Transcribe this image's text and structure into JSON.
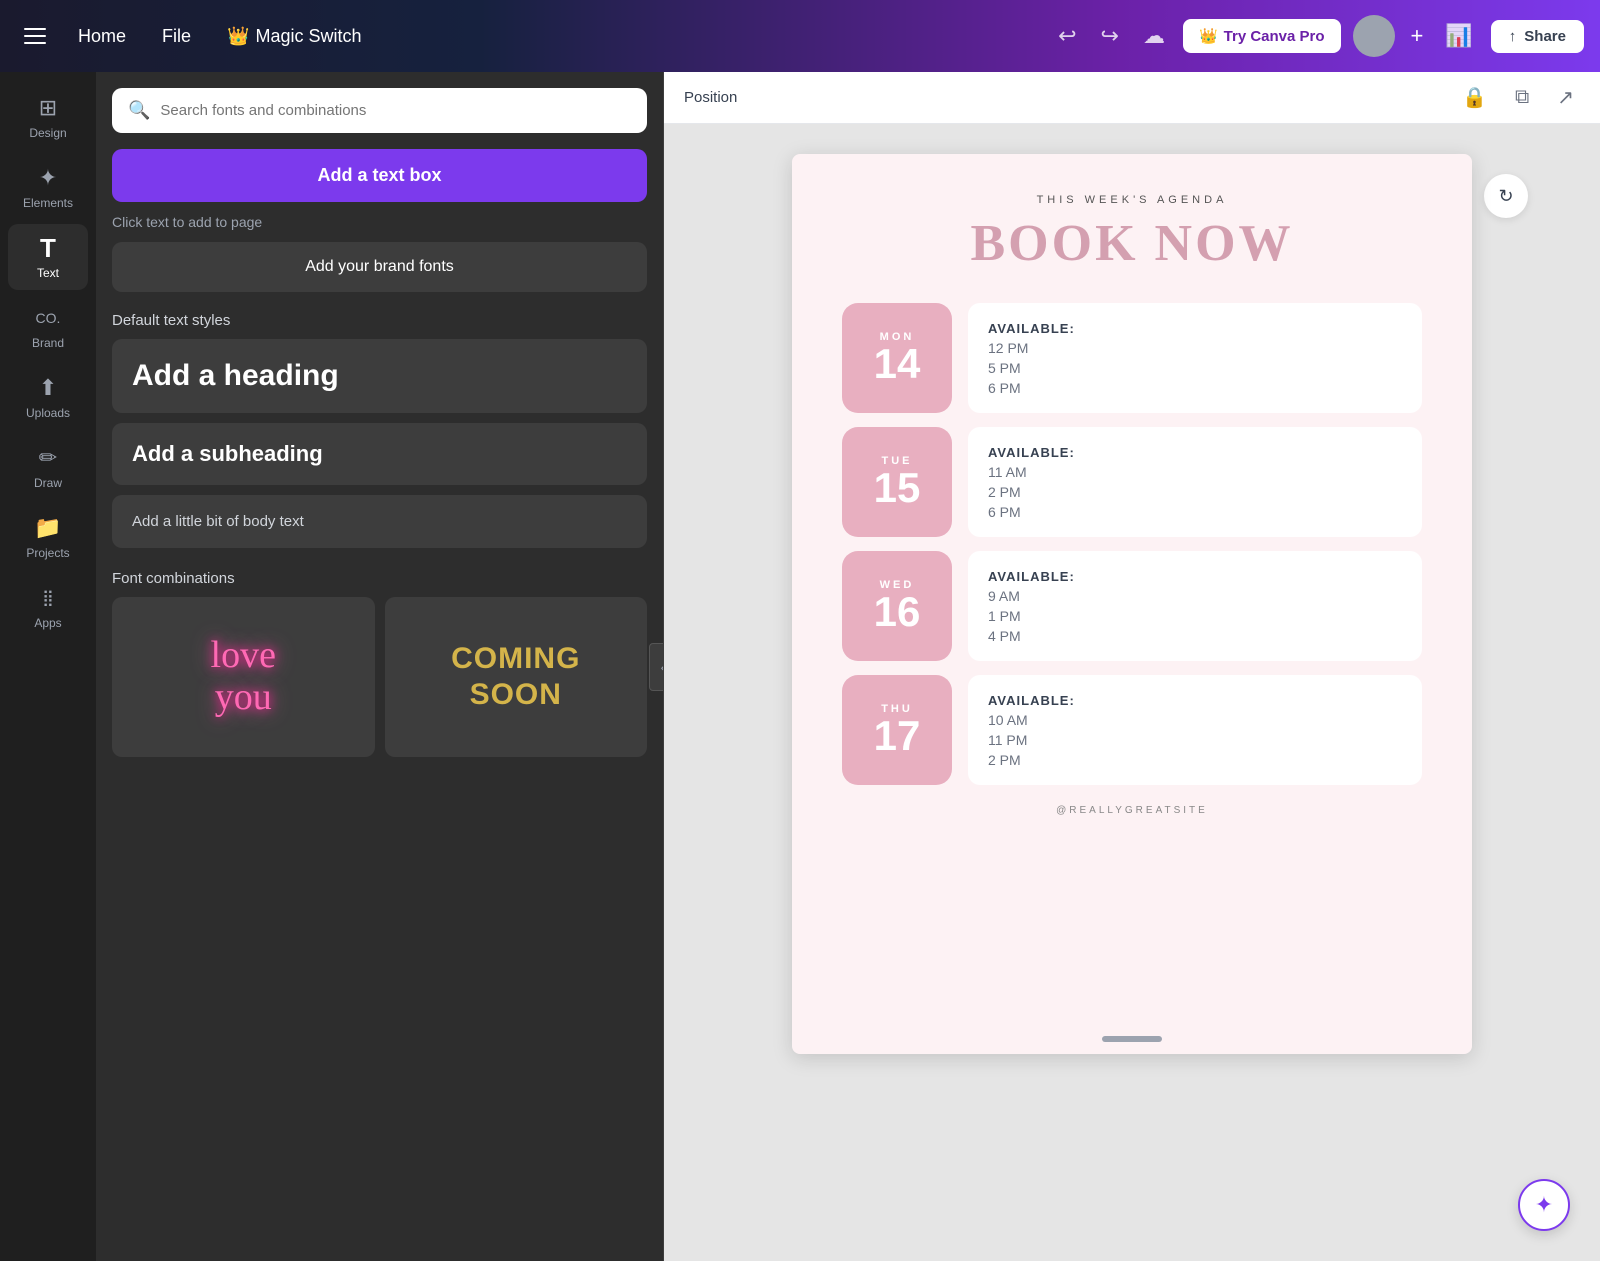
{
  "topnav": {
    "home": "Home",
    "file": "File",
    "magic_switch": "Magic Switch",
    "try_pro": "Try Canva Pro",
    "share": "Share"
  },
  "sidebar": {
    "items": [
      {
        "id": "design",
        "label": "Design",
        "icon": "⊞"
      },
      {
        "id": "elements",
        "label": "Elements",
        "icon": "✦"
      },
      {
        "id": "text",
        "label": "Text",
        "icon": "T"
      },
      {
        "id": "brand",
        "label": "Brand",
        "icon": "🏢"
      },
      {
        "id": "uploads",
        "label": "Uploads",
        "icon": "↑"
      },
      {
        "id": "draw",
        "label": "Draw",
        "icon": "✏️"
      },
      {
        "id": "projects",
        "label": "Projects",
        "icon": "📁"
      },
      {
        "id": "apps",
        "label": "Apps",
        "icon": "⋮⋮⋮"
      }
    ]
  },
  "tools": {
    "search_placeholder": "Search fonts and combinations",
    "add_textbox": "Add a text box",
    "click_hint": "Click text to add to page",
    "brand_fonts": "Add your brand fonts",
    "default_styles_label": "Default text styles",
    "heading": "Add a heading",
    "subheading": "Add a subheading",
    "body": "Add a little bit of body text",
    "font_combos_label": "Font combinations",
    "combo1_line1": "love",
    "combo1_line2": "you",
    "combo2_line1": "COMING",
    "combo2_line2": "SOON"
  },
  "position_bar": {
    "label": "Position"
  },
  "canvas": {
    "agenda_label": "THIS WEEK'S AGENDA",
    "title": "BOOK NOW",
    "days": [
      {
        "day_abbr": "MON",
        "day_num": "14",
        "available_label": "AVAILABLE:",
        "times": [
          "12 PM",
          "5 PM",
          "6 PM"
        ]
      },
      {
        "day_abbr": "TUE",
        "day_num": "15",
        "available_label": "AVAILABLE:",
        "times": [
          "11 AM",
          "2 PM",
          "6 PM"
        ]
      },
      {
        "day_abbr": "WED",
        "day_num": "16",
        "available_label": "AVAILABLE:",
        "times": [
          "9 AM",
          "1 PM",
          "4 PM"
        ]
      },
      {
        "day_abbr": "THU",
        "day_num": "17",
        "available_label": "AVAILABLE:",
        "times": [
          "10 AM",
          "11 PM",
          "2 PM"
        ]
      }
    ],
    "footer": "@REALLYGREATSITE"
  }
}
